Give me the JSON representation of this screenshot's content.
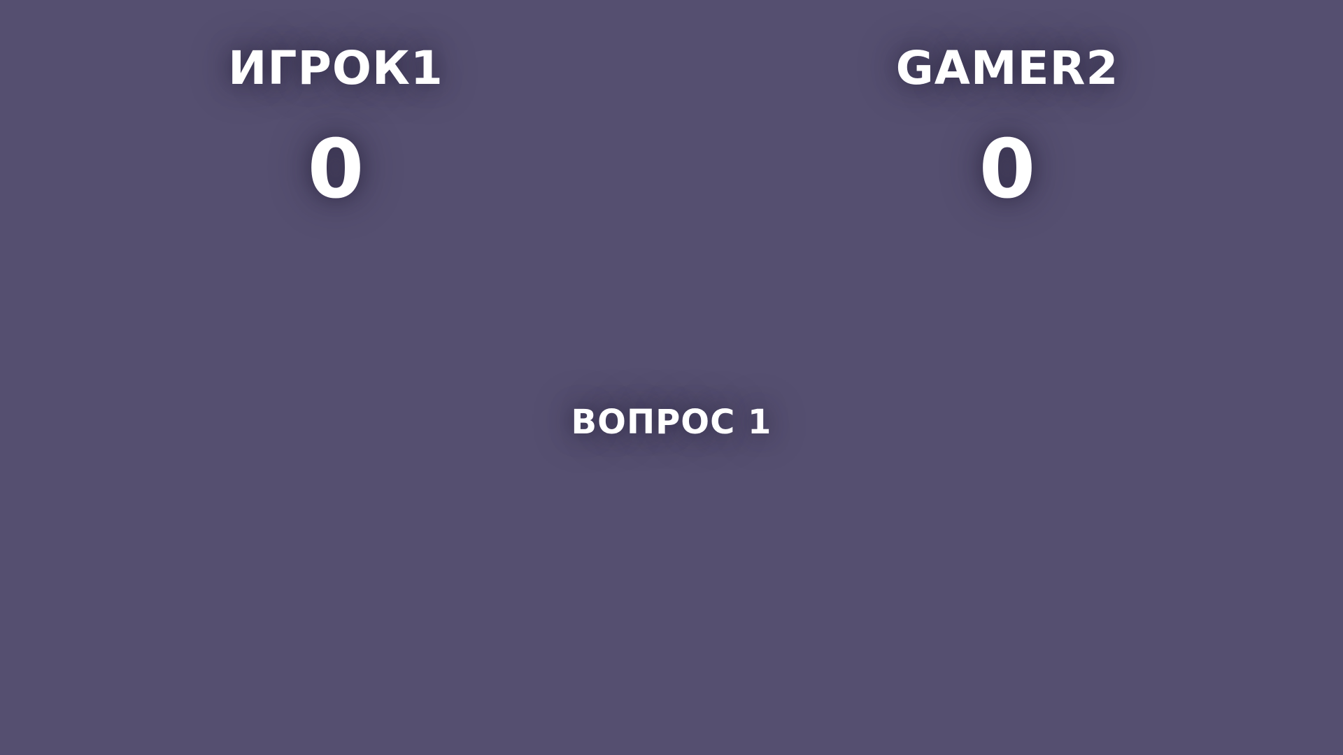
{
  "players": [
    {
      "name": "ИГРОК1",
      "score": "0"
    },
    {
      "name": "GAMER2",
      "score": "0"
    }
  ],
  "question": {
    "label": "ВОПРОС 1"
  },
  "colors": {
    "background": "#554f70",
    "text": "#ffffff"
  }
}
